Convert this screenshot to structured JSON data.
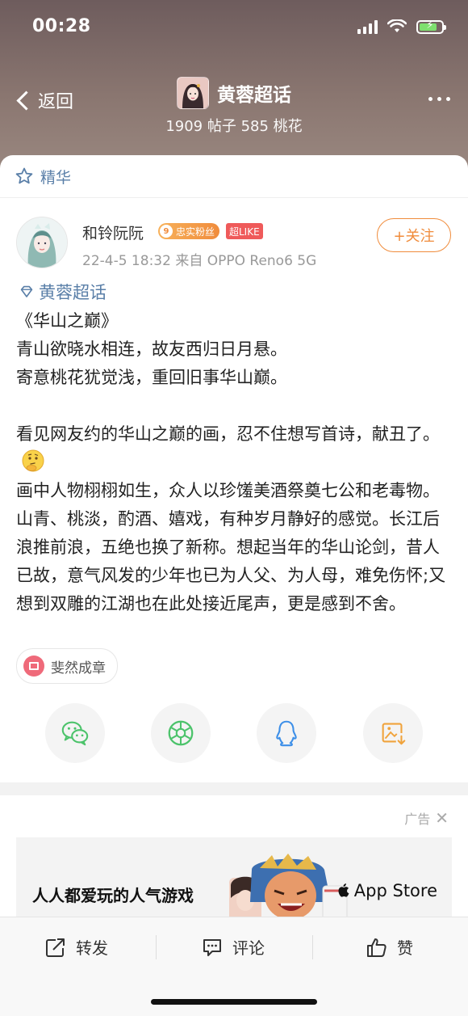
{
  "status_bar": {
    "time": "00:28"
  },
  "header": {
    "back_label": "返回",
    "title": "黄蓉超话",
    "subtitle": "1909 帖子 585 桃花"
  },
  "featured": {
    "label": "精华"
  },
  "post": {
    "author": "和铃阮阮",
    "fan_level": "9",
    "fan_badge": "忠实粉丝",
    "like_badge": "超LIKE",
    "meta": "22-4-5 18:32  来自 OPPO Reno6 5G",
    "follow_label": "+关注",
    "topic": "黄蓉超话",
    "lines": [
      "《华山之巅》",
      "青山欲晓水相连，故友西归日月悬。",
      "寄意桃花犹觉浅，重回旧事华山巅。",
      "",
      "看见网友约的华山之巅的画，忍不住想写首诗，献丑了。",
      "画中人物栩栩如生，众人以珍馐美酒祭奠七公和老毒物。山青、桃淡，酌酒、嬉戏，有种岁月静好的感觉。长江后浪推前浪，五绝也换了新称。想起当年的华山论剑，昔人已故，意气风发的少年也已为人父、为人母，难免伤怀;又想到双雕的江湖也在此处接近尾声，更是感到不舍。"
    ],
    "tag": "斐然成章"
  },
  "share": {
    "icons": [
      "wechat-icon",
      "moments-icon",
      "qq-icon",
      "save-image-icon"
    ]
  },
  "ad": {
    "label": "广告",
    "close": "✕",
    "text": "人人都爱玩的人气游戏",
    "store": "App Store"
  },
  "actions": {
    "repost": "转发",
    "comment": "评论",
    "like": "赞"
  },
  "colors": {
    "accent_orange": "#f08c3c",
    "link_blue": "#5a7fa8",
    "wechat_green": "#4cc36b",
    "qq_blue": "#3d8fe8",
    "save_orange": "#f0a33c"
  }
}
